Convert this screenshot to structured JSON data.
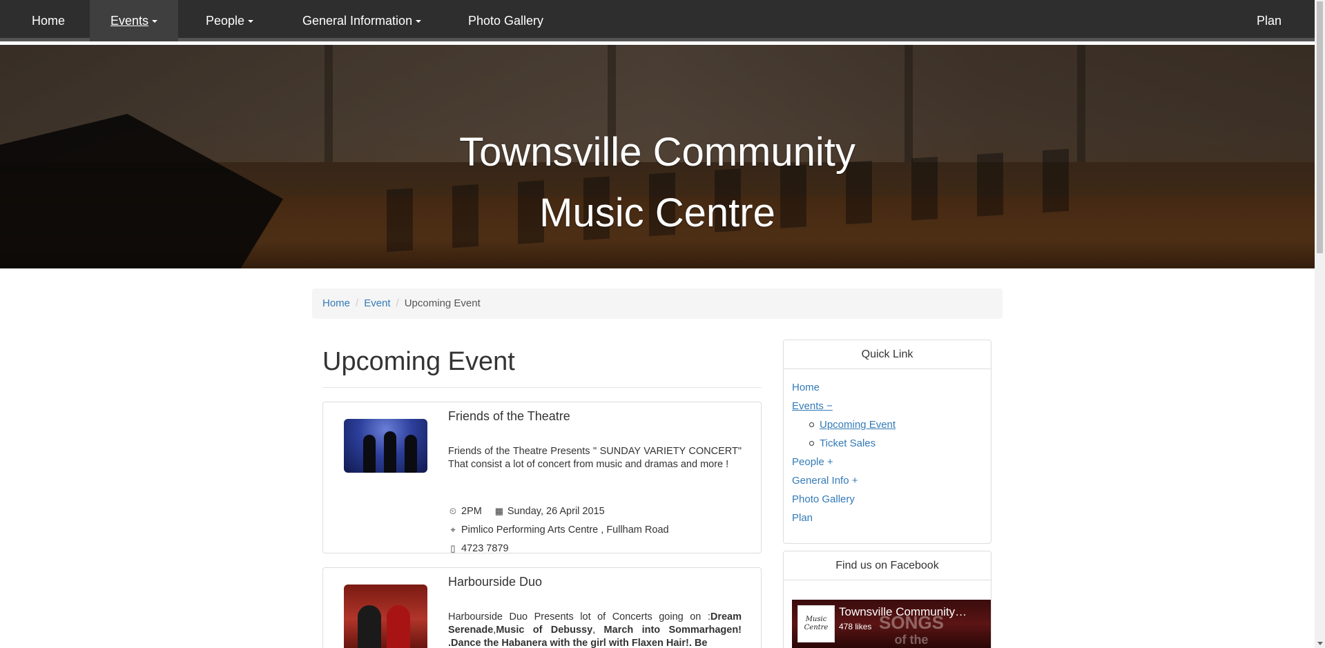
{
  "nav": {
    "home": "Home",
    "events": "Events",
    "people": "People",
    "general_info": "General Information",
    "photo_gallery": "Photo Gallery",
    "plan": "Plan"
  },
  "hero": {
    "title_line1": "Townsville Community",
    "title_line2": "Music Centre"
  },
  "breadcrumb": {
    "items": [
      "Home",
      "Event",
      "Upcoming Event"
    ]
  },
  "main": {
    "heading": "Upcoming Event",
    "events": [
      {
        "title": "Friends of the Theatre",
        "description": "Friends of the Theatre Presents \" SUNDAY VARIETY CONCERT\" That consist a lot of concert from music and dramas and more !",
        "time": "2PM",
        "date": "Sunday, 26 April 2015",
        "location": "Pimlico Performing Arts Centre , Fullham Road",
        "phone": "4723 7879"
      },
      {
        "title": "Harbourside Duo",
        "description_prefix": "Harbourside Duo Presents lot of Concerts going on :",
        "description_bold_1": "Dream Serenade",
        "description_sep_1": ",",
        "description_bold_2": "Music of Debussy",
        "description_sep_2": ", ",
        "description_bold_3": "March into Sommarhagen! .Dance the Habanera with the girl with Flaxen Hair!. Be"
      }
    ]
  },
  "sidebar": {
    "quick_link": {
      "heading": "Quick Link",
      "home": "Home",
      "events": "Events −",
      "upcoming_event": "Upcoming Event",
      "ticket_sales": "Ticket Sales",
      "people": "People +",
      "general_info": "General Info +",
      "photo_gallery": "Photo Gallery",
      "plan": "Plan"
    },
    "facebook": {
      "heading": "Find us on Facebook",
      "page_name": "Townsville Community…",
      "likes": "478 likes",
      "logo_text": "Music Centre",
      "bg_text_1": "SONGS",
      "bg_text_2": "of the"
    }
  },
  "icons": {
    "time": "clock-icon",
    "date": "calendar-icon",
    "location": "map-marker-icon",
    "phone": "phone-icon"
  },
  "colors": {
    "navbar_bg": "#2e2e2e",
    "link": "#337ab7"
  }
}
